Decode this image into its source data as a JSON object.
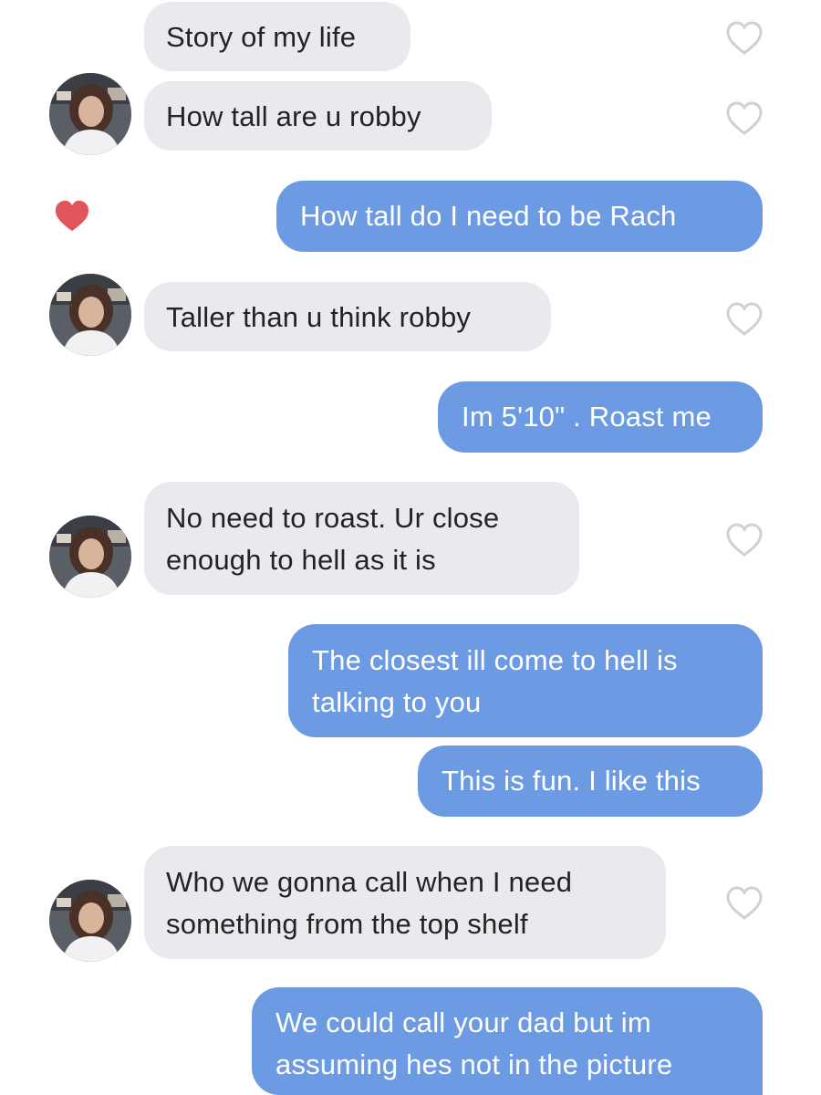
{
  "colors": {
    "incoming_bubble": "#e9eaee",
    "outgoing_bubble": "#6d9be3",
    "liked_heart": "#e0545a",
    "outline_heart": "#cfd1d6"
  },
  "icons": {
    "contact_avatar": "person-photo",
    "like_outline": "heart-outline-icon",
    "like_filled": "heart-filled-icon"
  },
  "messages": [
    {
      "sender": "contact",
      "text": "Story of my life",
      "avatar": false,
      "liked": false
    },
    {
      "sender": "contact",
      "text": "How tall are u robby",
      "avatar": true,
      "liked": false
    },
    {
      "sender": "me",
      "text": "How tall do I need to be Rach",
      "liked": true
    },
    {
      "sender": "contact",
      "text": "Taller than u think robby",
      "avatar": true,
      "liked": false
    },
    {
      "sender": "me",
      "text": "Im 5'10\" . Roast me"
    },
    {
      "sender": "contact",
      "text": "No need to roast. Ur close\nenough to hell as it is",
      "avatar": true,
      "liked": false
    },
    {
      "sender": "me",
      "text": "The closest ill come to hell is\ntalking to you"
    },
    {
      "sender": "me",
      "text": "This is fun. I like this"
    },
    {
      "sender": "contact",
      "text": "Who we gonna call when I need\nsomething from the top shelf",
      "avatar": true,
      "liked": false
    },
    {
      "sender": "me",
      "text": "We could call your dad but im\nassuming hes not in the picture"
    }
  ]
}
